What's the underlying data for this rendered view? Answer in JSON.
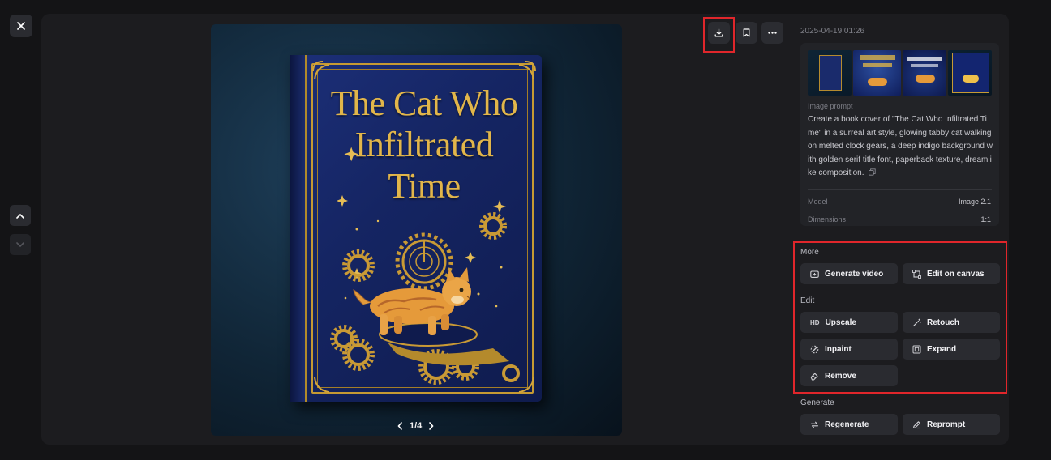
{
  "icons": {
    "close": "close-icon",
    "nav_up": "chevron-up-icon",
    "nav_down": "chevron-down-icon",
    "download": "download-icon",
    "bookmark": "bookmark-icon",
    "more": "more-horizontal-icon",
    "prev": "chevron-left-icon",
    "next": "chevron-right-icon",
    "copy": "copy-icon"
  },
  "viewer": {
    "book_title_lines": [
      "The Cat Who",
      "Infiltrated",
      "Time"
    ],
    "pager": "1/4"
  },
  "details": {
    "timestamp": "2025-04-19 01:26",
    "prompt_label": "Image prompt",
    "prompt_text": "Create a book cover of \"The Cat Who Infiltrated Time\" in a surreal art style, glowing tabby cat walking on melted clock gears, a deep indigo background with golden serif title font, paperback texture, dreamlike composition.",
    "model_label": "Model",
    "model_value": "Image 2.1",
    "dimensions_label": "Dimensions",
    "dimensions_value": "1:1"
  },
  "actions": {
    "more_label": "More",
    "generate_video": "Generate video",
    "edit_on_canvas": "Edit on canvas",
    "edit_label": "Edit",
    "upscale_badge": "HD",
    "upscale": "Upscale",
    "retouch": "Retouch",
    "inpaint": "Inpaint",
    "expand": "Expand",
    "remove": "Remove",
    "generate_label": "Generate",
    "regenerate": "Regenerate",
    "reprompt": "Reprompt"
  },
  "colors": {
    "highlight": "#e0262b",
    "gold": "#e2b64a",
    "indigo": "#152563"
  }
}
